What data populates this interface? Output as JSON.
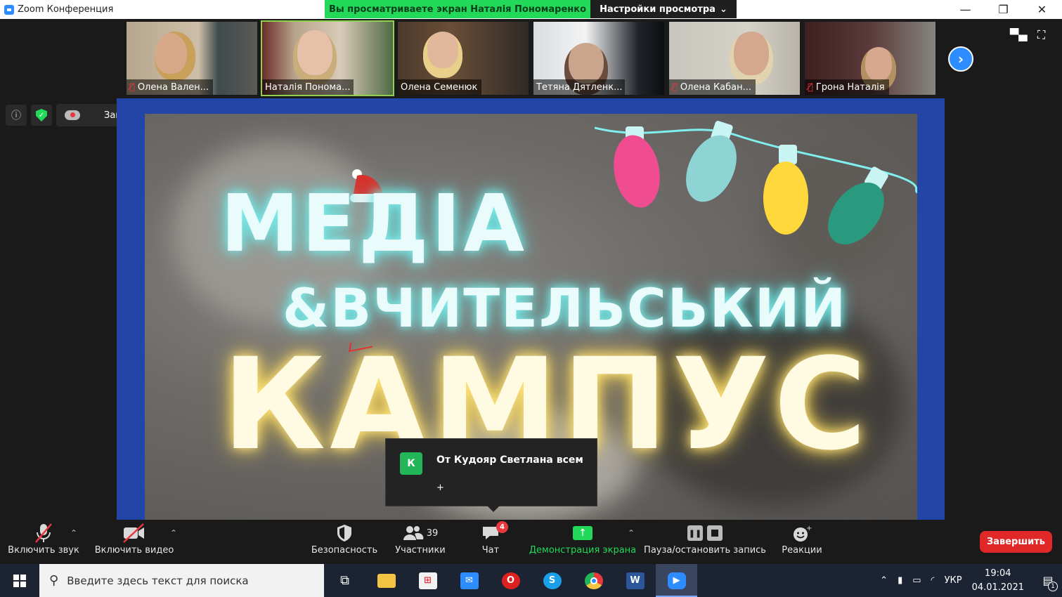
{
  "window": {
    "title": "Zoom Конференция",
    "share_banner": "Вы просматриваете экран Наталія Пономаренко",
    "view_options": "Настройки просмотра"
  },
  "participants": [
    {
      "name": "Олена Вален...",
      "muted": true
    },
    {
      "name": "Наталія Понома...",
      "muted": false,
      "active": true
    },
    {
      "name": "Олена Семенюк",
      "muted": false
    },
    {
      "name": "Тетяна Дятленк...",
      "muted": false
    },
    {
      "name": "Олена Кабан...",
      "muted": true
    },
    {
      "name": "Грона Наталія",
      "muted": true
    }
  ],
  "recording": {
    "label": "Запись..."
  },
  "slide": {
    "line1": "МЕДІА",
    "line2": "&ВЧИТЕЛЬСЬКИЙ",
    "line3": "КАМПУС"
  },
  "chat_toast": {
    "avatar_letter": "К",
    "from": "От Кудояр Светлана всем",
    "message": "+"
  },
  "toolbar": {
    "audio": "Включить звук",
    "video": "Включить видео",
    "security": "Безопасность",
    "participants": "Участники",
    "participants_count": "39",
    "chat": "Чат",
    "chat_badge": "4",
    "share": "Демонстрация экрана",
    "record": "Пауза/остановить запись",
    "reactions": "Реакции",
    "end": "Завершить"
  },
  "taskbar": {
    "search_placeholder": "Введите здесь текст для поиска",
    "lang": "УКР",
    "time": "19:04",
    "date": "04.01.2021",
    "notif_count": "1"
  },
  "colors": {
    "zoom_blue": "#2d8cff",
    "share_green": "#23d959",
    "end_red": "#e02828"
  }
}
